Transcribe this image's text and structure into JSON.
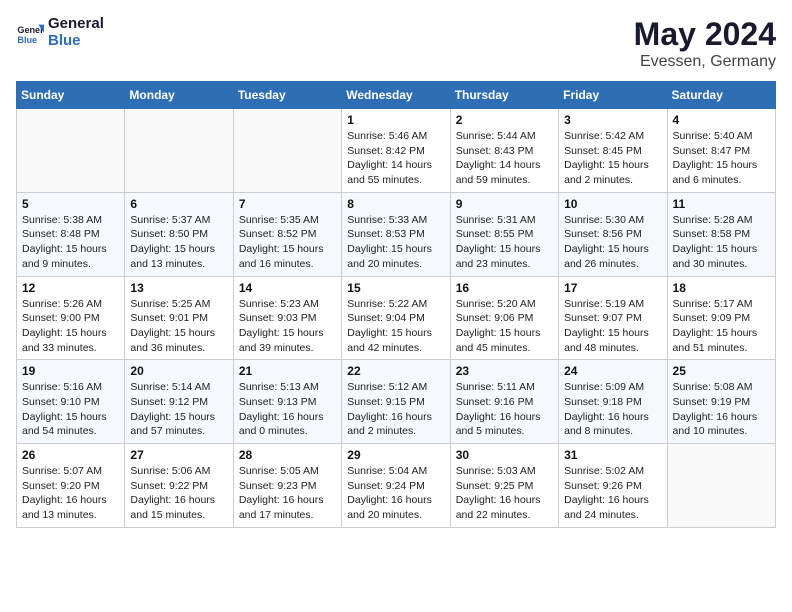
{
  "logo": {
    "line1": "General",
    "line2": "Blue"
  },
  "title": "May 2024",
  "subtitle": "Evessen, Germany",
  "weekdays": [
    "Sunday",
    "Monday",
    "Tuesday",
    "Wednesday",
    "Thursday",
    "Friday",
    "Saturday"
  ],
  "weeks": [
    [
      {
        "day": "",
        "info": ""
      },
      {
        "day": "",
        "info": ""
      },
      {
        "day": "",
        "info": ""
      },
      {
        "day": "1",
        "info": "Sunrise: 5:46 AM\nSunset: 8:42 PM\nDaylight: 14 hours\nand 55 minutes."
      },
      {
        "day": "2",
        "info": "Sunrise: 5:44 AM\nSunset: 8:43 PM\nDaylight: 14 hours\nand 59 minutes."
      },
      {
        "day": "3",
        "info": "Sunrise: 5:42 AM\nSunset: 8:45 PM\nDaylight: 15 hours\nand 2 minutes."
      },
      {
        "day": "4",
        "info": "Sunrise: 5:40 AM\nSunset: 8:47 PM\nDaylight: 15 hours\nand 6 minutes."
      }
    ],
    [
      {
        "day": "5",
        "info": "Sunrise: 5:38 AM\nSunset: 8:48 PM\nDaylight: 15 hours\nand 9 minutes."
      },
      {
        "day": "6",
        "info": "Sunrise: 5:37 AM\nSunset: 8:50 PM\nDaylight: 15 hours\nand 13 minutes."
      },
      {
        "day": "7",
        "info": "Sunrise: 5:35 AM\nSunset: 8:52 PM\nDaylight: 15 hours\nand 16 minutes."
      },
      {
        "day": "8",
        "info": "Sunrise: 5:33 AM\nSunset: 8:53 PM\nDaylight: 15 hours\nand 20 minutes."
      },
      {
        "day": "9",
        "info": "Sunrise: 5:31 AM\nSunset: 8:55 PM\nDaylight: 15 hours\nand 23 minutes."
      },
      {
        "day": "10",
        "info": "Sunrise: 5:30 AM\nSunset: 8:56 PM\nDaylight: 15 hours\nand 26 minutes."
      },
      {
        "day": "11",
        "info": "Sunrise: 5:28 AM\nSunset: 8:58 PM\nDaylight: 15 hours\nand 30 minutes."
      }
    ],
    [
      {
        "day": "12",
        "info": "Sunrise: 5:26 AM\nSunset: 9:00 PM\nDaylight: 15 hours\nand 33 minutes."
      },
      {
        "day": "13",
        "info": "Sunrise: 5:25 AM\nSunset: 9:01 PM\nDaylight: 15 hours\nand 36 minutes."
      },
      {
        "day": "14",
        "info": "Sunrise: 5:23 AM\nSunset: 9:03 PM\nDaylight: 15 hours\nand 39 minutes."
      },
      {
        "day": "15",
        "info": "Sunrise: 5:22 AM\nSunset: 9:04 PM\nDaylight: 15 hours\nand 42 minutes."
      },
      {
        "day": "16",
        "info": "Sunrise: 5:20 AM\nSunset: 9:06 PM\nDaylight: 15 hours\nand 45 minutes."
      },
      {
        "day": "17",
        "info": "Sunrise: 5:19 AM\nSunset: 9:07 PM\nDaylight: 15 hours\nand 48 minutes."
      },
      {
        "day": "18",
        "info": "Sunrise: 5:17 AM\nSunset: 9:09 PM\nDaylight: 15 hours\nand 51 minutes."
      }
    ],
    [
      {
        "day": "19",
        "info": "Sunrise: 5:16 AM\nSunset: 9:10 PM\nDaylight: 15 hours\nand 54 minutes."
      },
      {
        "day": "20",
        "info": "Sunrise: 5:14 AM\nSunset: 9:12 PM\nDaylight: 15 hours\nand 57 minutes."
      },
      {
        "day": "21",
        "info": "Sunrise: 5:13 AM\nSunset: 9:13 PM\nDaylight: 16 hours\nand 0 minutes."
      },
      {
        "day": "22",
        "info": "Sunrise: 5:12 AM\nSunset: 9:15 PM\nDaylight: 16 hours\nand 2 minutes."
      },
      {
        "day": "23",
        "info": "Sunrise: 5:11 AM\nSunset: 9:16 PM\nDaylight: 16 hours\nand 5 minutes."
      },
      {
        "day": "24",
        "info": "Sunrise: 5:09 AM\nSunset: 9:18 PM\nDaylight: 16 hours\nand 8 minutes."
      },
      {
        "day": "25",
        "info": "Sunrise: 5:08 AM\nSunset: 9:19 PM\nDaylight: 16 hours\nand 10 minutes."
      }
    ],
    [
      {
        "day": "26",
        "info": "Sunrise: 5:07 AM\nSunset: 9:20 PM\nDaylight: 16 hours\nand 13 minutes."
      },
      {
        "day": "27",
        "info": "Sunrise: 5:06 AM\nSunset: 9:22 PM\nDaylight: 16 hours\nand 15 minutes."
      },
      {
        "day": "28",
        "info": "Sunrise: 5:05 AM\nSunset: 9:23 PM\nDaylight: 16 hours\nand 17 minutes."
      },
      {
        "day": "29",
        "info": "Sunrise: 5:04 AM\nSunset: 9:24 PM\nDaylight: 16 hours\nand 20 minutes."
      },
      {
        "day": "30",
        "info": "Sunrise: 5:03 AM\nSunset: 9:25 PM\nDaylight: 16 hours\nand 22 minutes."
      },
      {
        "day": "31",
        "info": "Sunrise: 5:02 AM\nSunset: 9:26 PM\nDaylight: 16 hours\nand 24 minutes."
      },
      {
        "day": "",
        "info": ""
      }
    ]
  ]
}
